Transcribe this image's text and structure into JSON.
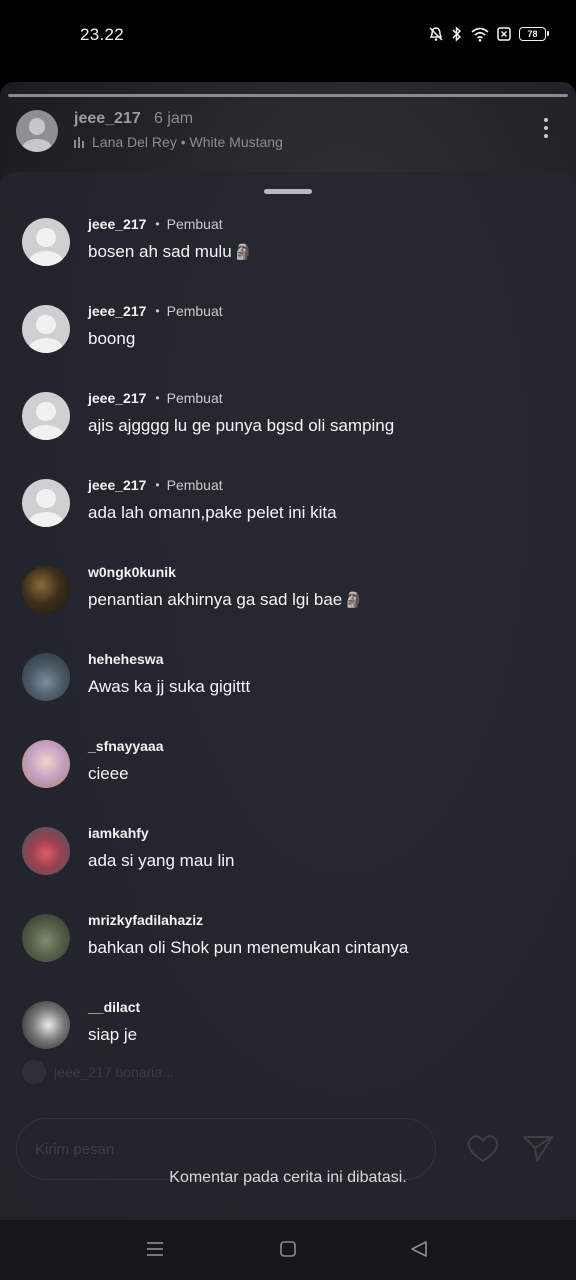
{
  "status_bar": {
    "time": "23.22",
    "battery": "78",
    "icons": [
      "mute-icon",
      "bluetooth-icon",
      "wifi-icon",
      "no-sim-icon",
      "battery-icon"
    ]
  },
  "story": {
    "username": "jeee_217",
    "time": "6 jam",
    "music": "Lana Del Rey • White Mustang"
  },
  "comments": [
    {
      "user": "jeee_217",
      "role": "Pembuat",
      "text": "bosen ah sad mulu",
      "emoji": "🗿",
      "avatar": "default"
    },
    {
      "user": "jeee_217",
      "role": "Pembuat",
      "text": "boong",
      "emoji": "",
      "avatar": "default"
    },
    {
      "user": "jeee_217",
      "role": "Pembuat",
      "text": "ajis ajgggg lu ge punya bgsd oli samping",
      "emoji": "",
      "avatar": "default"
    },
    {
      "user": "jeee_217",
      "role": "Pembuat",
      "text": "ada lah omann,pake pelet ini kita",
      "emoji": "",
      "avatar": "default"
    },
    {
      "user": "w0ngk0kunik",
      "role": "",
      "text": "penantian akhirnya ga sad lgi bae",
      "emoji": "🗿",
      "avatar": "photo1"
    },
    {
      "user": "heheheswa",
      "role": "",
      "text": "Awas ka jj suka gigittt",
      "emoji": "",
      "avatar": "photo2"
    },
    {
      "user": "_sfnayyaaa",
      "role": "",
      "text": "cieee",
      "emoji": "",
      "avatar": "photo3"
    },
    {
      "user": "iamkahfy",
      "role": "",
      "text": "ada si yang mau lin",
      "emoji": "",
      "avatar": "photo4"
    },
    {
      "user": "mrizkyfadilahaziz",
      "role": "",
      "text": "bahkan oli Shok pun menemukan cintanya",
      "emoji": "",
      "avatar": "photo5"
    },
    {
      "user": "__dilact",
      "role": "",
      "text": "siap je",
      "emoji": "",
      "avatar": "photo6"
    }
  ],
  "background_faint": {
    "seen_by": "jeee_217 bonaria...",
    "input_placeholder": "Kirim pesan"
  },
  "restricted_notice": "Komentar pada cerita ini dibatasi."
}
